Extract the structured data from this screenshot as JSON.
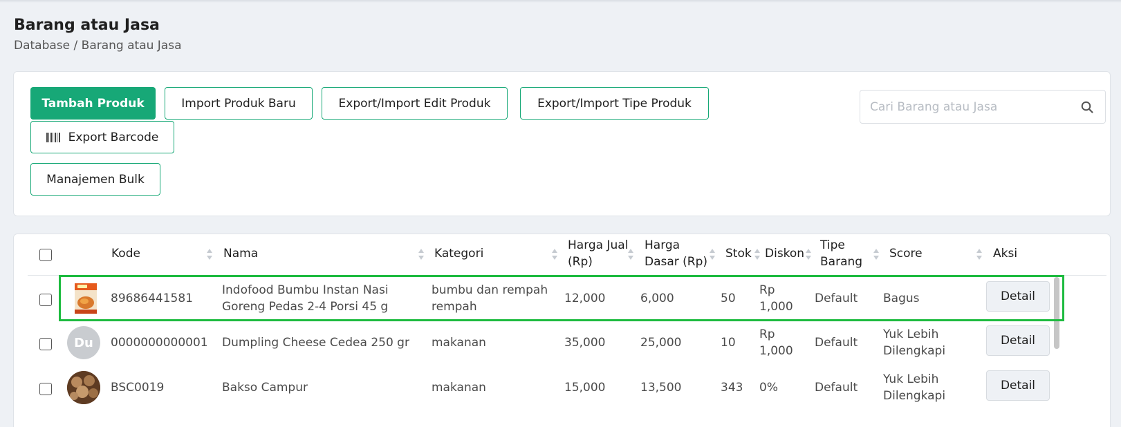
{
  "header": {
    "title": "Barang atau Jasa",
    "breadcrumb": "Database / Barang atau Jasa"
  },
  "toolbar": {
    "add_product": "Tambah Produk",
    "import_new": "Import Produk Baru",
    "export_import_edit": "Export/Import Edit Produk",
    "export_import_type": "Export/Import Tipe Produk",
    "export_barcode": "Export Barcode",
    "bulk_management": "Manajemen Bulk",
    "search_placeholder": "Cari Barang atau Jasa",
    "search_value": ""
  },
  "colors": {
    "accent": "#17a877",
    "highlight": "#1dbb3f"
  },
  "table": {
    "columns": {
      "kode": "Kode",
      "nama": "Nama",
      "kategori": "Kategori",
      "harga_jual_1": "Harga Jual",
      "harga_jual_2": "(Rp)",
      "harga_dasar_1": "Harga",
      "harga_dasar_2": "Dasar (Rp)",
      "stok": "Stok",
      "diskon": "Diskon",
      "tipe_1": "Tipe",
      "tipe_2": "Barang",
      "score": "Score",
      "aksi": "Aksi"
    },
    "rows": [
      {
        "thumb": "product-image",
        "kode": "89686441581",
        "nama_1": "Indofood Bumbu Instan Nasi",
        "nama_2": "Goreng Pedas 2-4 Porsi 45 g",
        "kategori_1": "bumbu dan rempah",
        "kategori_2": "rempah",
        "harga_jual": "12,000",
        "harga_dasar": "6,000",
        "stok": "50",
        "diskon_1": "Rp",
        "diskon_2": "1,000",
        "tipe": "Default",
        "score_1": "Bagus",
        "score_2": "",
        "aksi": "Detail"
      },
      {
        "thumb": "Du",
        "kode": "0000000000001",
        "nama_1": "Dumpling Cheese Cedea 250 gr",
        "nama_2": "",
        "kategori_1": "makanan",
        "kategori_2": "",
        "harga_jual": "35,000",
        "harga_dasar": "25,000",
        "stok": "10",
        "diskon_1": "Rp",
        "diskon_2": "1,000",
        "tipe": "Default",
        "score_1": "Yuk Lebih",
        "score_2": "Dilengkapi",
        "aksi": "Detail"
      },
      {
        "thumb": "product-image",
        "kode": "BSC0019",
        "nama_1": "Bakso Campur",
        "nama_2": "",
        "kategori_1": "makanan",
        "kategori_2": "",
        "harga_jual": "15,000",
        "harga_dasar": "13,500",
        "stok": "343",
        "diskon_1": "0%",
        "diskon_2": "",
        "tipe": "Default",
        "score_1": "Yuk Lebih",
        "score_2": "Dilengkapi",
        "aksi": "Detail"
      }
    ]
  }
}
